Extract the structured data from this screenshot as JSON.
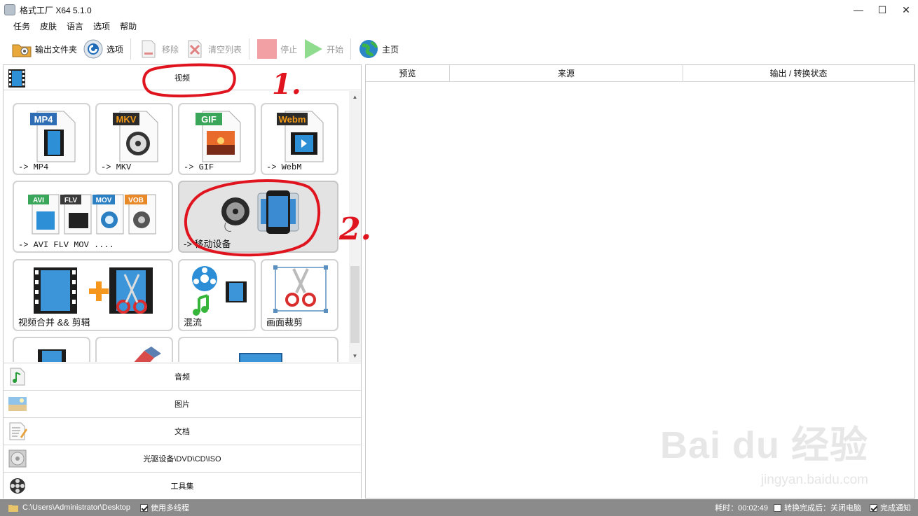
{
  "window": {
    "title": "格式工厂 X64 5.1.0",
    "minimize": "—",
    "maximize": "☐",
    "close": "✕"
  },
  "menu": [
    "任务",
    "皮肤",
    "语言",
    "选项",
    "帮助"
  ],
  "toolbar": {
    "output_folder": "输出文件夹",
    "options": "选项",
    "remove": "移除",
    "clear_list": "清空列表",
    "stop": "停止",
    "start": "开始",
    "home": "主页"
  },
  "left": {
    "video_header": "视频",
    "tiles": [
      {
        "label": "-> MP4",
        "badge": "MP4",
        "badge_color": "#2f6db5"
      },
      {
        "label": "-> MKV",
        "badge": "MKV",
        "badge_color": "#2b2b2b",
        "badge_text_color": "#f59a16"
      },
      {
        "label": "-> GIF",
        "badge": "GIF",
        "badge_color": "#3aa65a"
      },
      {
        "label": "-> WebM",
        "badge": "Webm",
        "badge_color": "#2b2b2b",
        "badge_text_color": "#f59a16"
      },
      {
        "label": "-> AVI FLV MOV ....",
        "badges": [
          "AVI",
          "FLV",
          "MOV",
          "VOB"
        ]
      },
      {
        "label": "-> 移动设备"
      },
      {
        "label": "视频合并 && 剪辑"
      },
      {
        "label": "混流"
      },
      {
        "label": "画面裁剪"
      }
    ],
    "scroll_up": "▲",
    "scroll_down": "▼",
    "categories": [
      {
        "label": "音频",
        "icon": "music-note-icon"
      },
      {
        "label": "图片",
        "icon": "picture-icon"
      },
      {
        "label": "文档",
        "icon": "document-icon"
      },
      {
        "label": "光驱设备\\DVD\\CD\\ISO",
        "icon": "disc-drive-icon"
      },
      {
        "label": "工具集",
        "icon": "film-reel-icon"
      }
    ]
  },
  "right": {
    "columns": [
      "预览",
      "来源",
      "输出 / 转换状态"
    ]
  },
  "status": {
    "path": "C:\\Users\\Administrator\\Desktop",
    "multithread": "使用多线程",
    "elapsed": "耗时：00:02:49",
    "after_done": "转换完成后：关闭电脑",
    "notify": "完成通知"
  },
  "annotations": {
    "step1": "1.",
    "step2": "2."
  },
  "watermark": {
    "brand": "Bai du 经验",
    "url": "jingyan.baidu.com"
  },
  "colors": {
    "statusbar": "#8b8b8b",
    "annotation_red": "#e0141e",
    "selected_tile": "#e3e3e3"
  }
}
